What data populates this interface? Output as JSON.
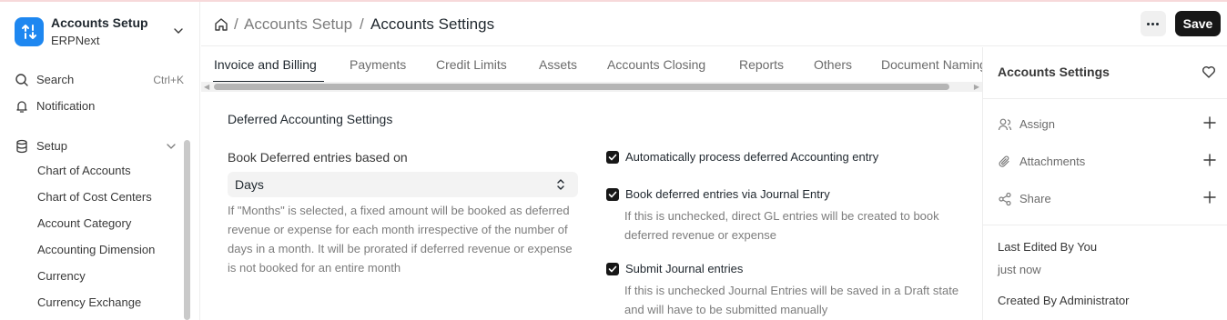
{
  "app": {
    "title": "Accounts Setup",
    "subtitle": "ERPNext"
  },
  "sidebar": {
    "search": {
      "label": "Search",
      "shortcut": "Ctrl+K",
      "icon": "search-icon"
    },
    "notification": {
      "label": "Notification",
      "icon": "bell-icon"
    },
    "setup": {
      "label": "Setup",
      "icon": "database-icon"
    },
    "items": [
      {
        "label": "Chart of Accounts"
      },
      {
        "label": "Chart of Cost Centers"
      },
      {
        "label": "Account Category"
      },
      {
        "label": "Accounting Dimension"
      },
      {
        "label": "Currency"
      },
      {
        "label": "Currency Exchange"
      }
    ]
  },
  "breadcrumb": {
    "parent": "Accounts Setup",
    "separator": "/",
    "current": "Accounts Settings"
  },
  "actions": {
    "save_label": "Save"
  },
  "tabs": [
    {
      "label": "Invoice and Billing",
      "active": true
    },
    {
      "label": "Payments"
    },
    {
      "label": "Credit Limits"
    },
    {
      "label": "Assets"
    },
    {
      "label": "Accounts Closing"
    },
    {
      "label": "Reports"
    },
    {
      "label": "Others"
    },
    {
      "label": "Document Naming"
    }
  ],
  "form": {
    "section_title": "Deferred Accounting Settings",
    "book_deferred": {
      "label": "Book Deferred entries based on",
      "value": "Days",
      "help": "If \"Months\" is selected, a fixed amount will be booked as deferred revenue or expense for each month irrespective of the number of days in a month. It will be prorated if deferred revenue or expense is not booked for an entire month"
    },
    "checks": [
      {
        "label": "Automatically process deferred Accounting entry",
        "checked": true,
        "help": ""
      },
      {
        "label": "Book deferred entries via Journal Entry",
        "checked": true,
        "help": "If this is unchecked, direct GL entries will be created to book deferred revenue or expense"
      },
      {
        "label": "Submit Journal entries",
        "checked": true,
        "help": "If this is unchecked Journal Entries will be saved in a Draft state and will have to be submitted manually"
      }
    ]
  },
  "right_panel": {
    "title": "Accounts Settings",
    "assign_label": "Assign",
    "attachments_label": "Attachments",
    "share_label": "Share",
    "last_edited": "Last Edited By You",
    "last_edited_time": "just now",
    "created_by": "Created By Administrator"
  },
  "colors": {
    "brand": "#1e87f0",
    "primary_button": "#171717",
    "checkbox": "#171717"
  }
}
